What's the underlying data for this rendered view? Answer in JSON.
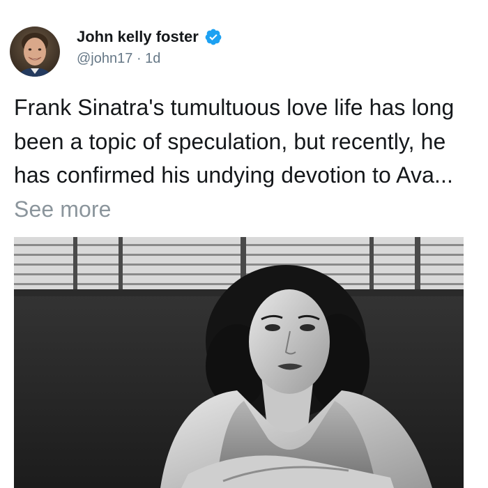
{
  "post": {
    "author": {
      "display_name": "John kelly foster",
      "handle": "@john17",
      "separator": "·",
      "age": "1d",
      "verified_icon": "verified-badge-icon",
      "badge_color": "#1da1f2"
    },
    "body": {
      "text": "Frank Sinatra's tumultuous love life has long been a topic of speculation, but recently, he has confirmed his undying devotion to Ava...",
      "see_more_label": "See more"
    },
    "media": {
      "description": "black and white portrait photo of a woman"
    }
  }
}
